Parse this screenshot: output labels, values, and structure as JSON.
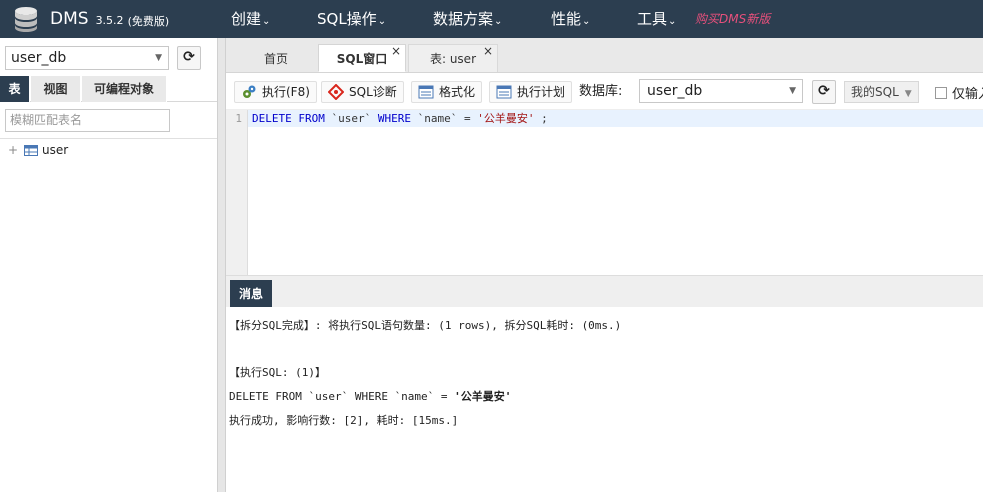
{
  "app": {
    "name": "DMS",
    "version": "3.5.2",
    "edition": "(免费版)",
    "buy_link": "购买DMS新版"
  },
  "nav": {
    "items": [
      {
        "label": "创建",
        "caret": "⌄"
      },
      {
        "label": "SQL操作",
        "caret": "⌄"
      },
      {
        "label": "数据方案",
        "caret": "⌄"
      },
      {
        "label": "性能",
        "caret": "⌄"
      },
      {
        "label": "工具",
        "caret": "⌄"
      }
    ]
  },
  "sidebar": {
    "db_select": "user_db",
    "tabs": [
      "表",
      "视图",
      "可编程对象"
    ],
    "active_tab": "表",
    "filter_placeholder": "模糊匹配表名",
    "tree": [
      {
        "label": "user",
        "expander": "+"
      }
    ]
  },
  "tabs": {
    "items": [
      {
        "label": "首页"
      },
      {
        "label": "SQL窗口",
        "close": "×"
      },
      {
        "label": "表: user",
        "close": "×"
      }
    ],
    "active": "SQL窗口"
  },
  "toolbar": {
    "execute": "执行(F8)",
    "diagnose": "SQL诊断",
    "format": "格式化",
    "plan": "执行计划",
    "db_label": "数据库:",
    "db_value": "user_db",
    "my_sql": "我的SQL",
    "only_input": "仅输入"
  },
  "editor": {
    "line_number": "1",
    "tokens": {
      "delete_from": "DELETE FROM",
      "table": "`user`",
      "where": "WHERE",
      "column": "`name`",
      "eq": "=",
      "value": "'公羊曼安'",
      "end": ";"
    }
  },
  "messages": {
    "tab_label": "消息",
    "lines": {
      "split_done": "【拆分SQL完成】: 将执行SQL语句数量: (1 rows), 拆分SQL耗时: (0ms.)",
      "exec_header": "【执行SQL: (1)】",
      "sql_prefix": "DELETE FROM `user` WHERE `name` = ",
      "sql_value": "'公羊曼安'",
      "result": "执行成功, 影响行数: [2], 耗时: [15ms.]"
    }
  },
  "colors": {
    "navbar": "#2c3e50",
    "buy_link": "#e8507c",
    "active_line": "#e8f2fe",
    "keyword": "#0000cc",
    "string": "#a31515"
  }
}
